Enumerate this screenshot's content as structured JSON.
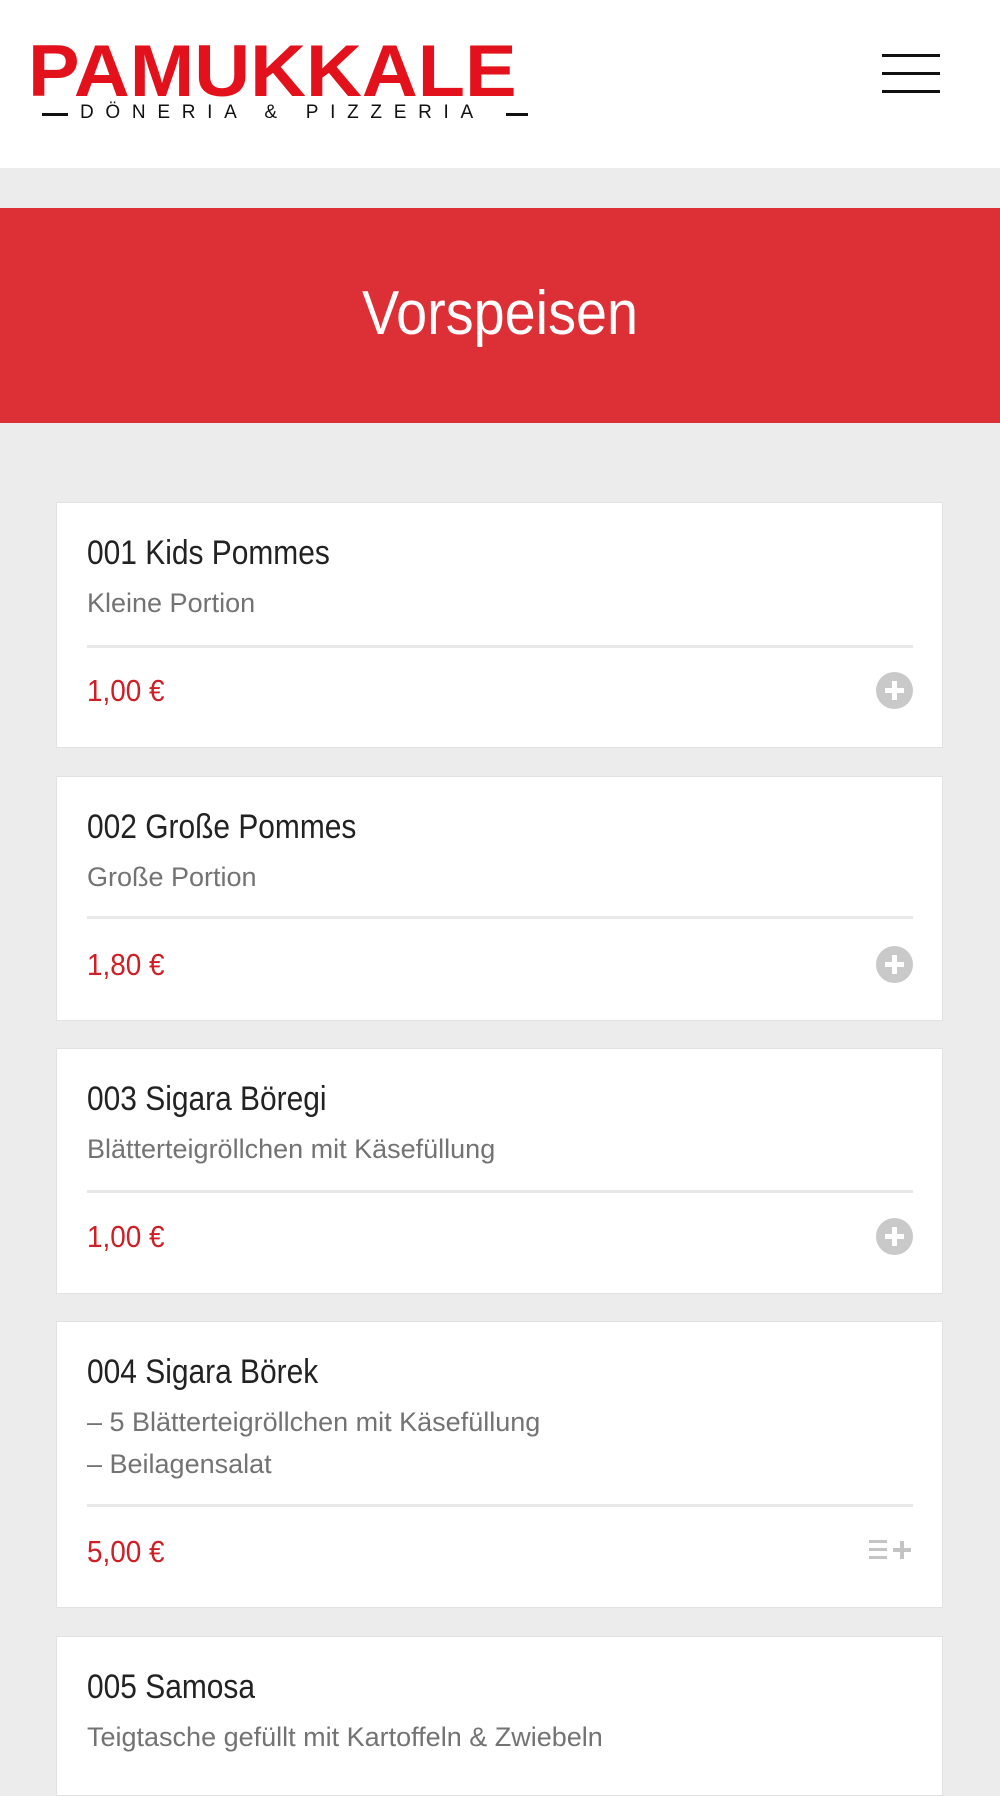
{
  "brand": {
    "name": "PAMUKKALE",
    "tagline": "DÖNERIA & PIZZERIA",
    "color": "#e3111b"
  },
  "header": {
    "menu_icon": "hamburger-menu-icon"
  },
  "category": {
    "title": "Vorspeisen",
    "color": "#dc3036"
  },
  "items": [
    {
      "title": "001 Kids Pommes",
      "description": [
        "Kleine Portion"
      ],
      "price": "1,00 €",
      "action_icon": "add-circle-icon"
    },
    {
      "title": "002 Große Pommes",
      "description": [
        "Große Portion"
      ],
      "price": "1,80 €",
      "action_icon": "add-circle-icon"
    },
    {
      "title": "003 Sigara Böregi",
      "description": [
        "Blätterteigröllchen mit Käsefüllung"
      ],
      "price": "1,00 €",
      "action_icon": "add-circle-icon"
    },
    {
      "title": "004 Sigara Börek",
      "description": [
        "– 5 Blätterteigröllchen mit Käsefüllung",
        "– Beilagensalat"
      ],
      "price": "5,00 €",
      "action_icon": "list-add-icon"
    },
    {
      "title": "005 Samosa",
      "description": [
        "Teigtasche gefüllt mit Kartoffeln & Zwiebeln"
      ]
    }
  ],
  "price_color": "#cf1f26"
}
